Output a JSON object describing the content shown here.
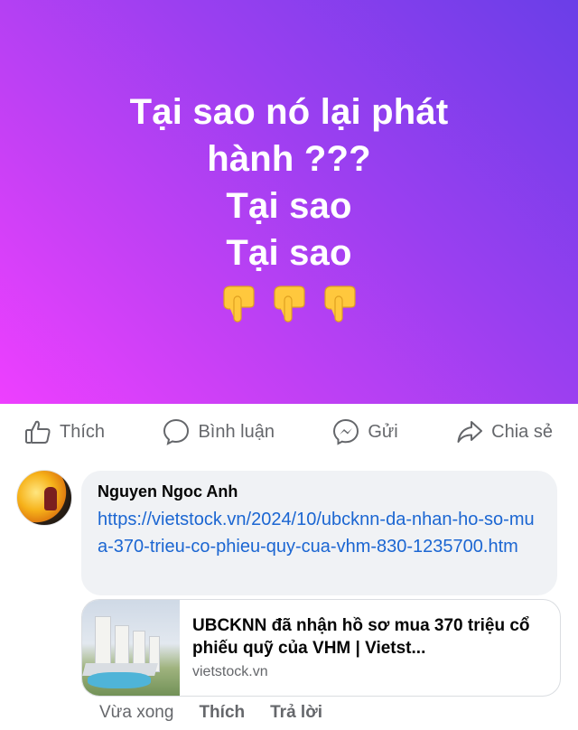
{
  "post": {
    "lines": [
      "Tại sao nó lại phát",
      "hành ???",
      "Tại sao",
      "Tại sao"
    ],
    "emoji": [
      "point-down-icon",
      "point-down-icon",
      "point-down-icon"
    ],
    "background_colors": [
      "#6a3ee8",
      "#ee3fff"
    ]
  },
  "actions": {
    "like": "Thích",
    "comment": "Bình luận",
    "send": "Gửi",
    "share": "Chia sẻ"
  },
  "comment": {
    "author": "Nguyen Ngoc Anh",
    "link_text": "https://vietstock.vn/2024/10/ubcknn-da-nhan-ho-so-mua-370-trieu-co-phieu-quy-cua-vhm-830-1235700.htm",
    "preview": {
      "title": "UBCKNN đã nhận hồ sơ mua 370 triệu cổ phiếu quỹ của VHM | Vietst...",
      "domain": "vietstock.vn"
    },
    "time": "Vừa xong",
    "like_label": "Thích",
    "reply_label": "Trả lời"
  },
  "colors": {
    "link": "#1b66d2",
    "muted": "#65676b",
    "bubble": "#f0f2f5"
  }
}
